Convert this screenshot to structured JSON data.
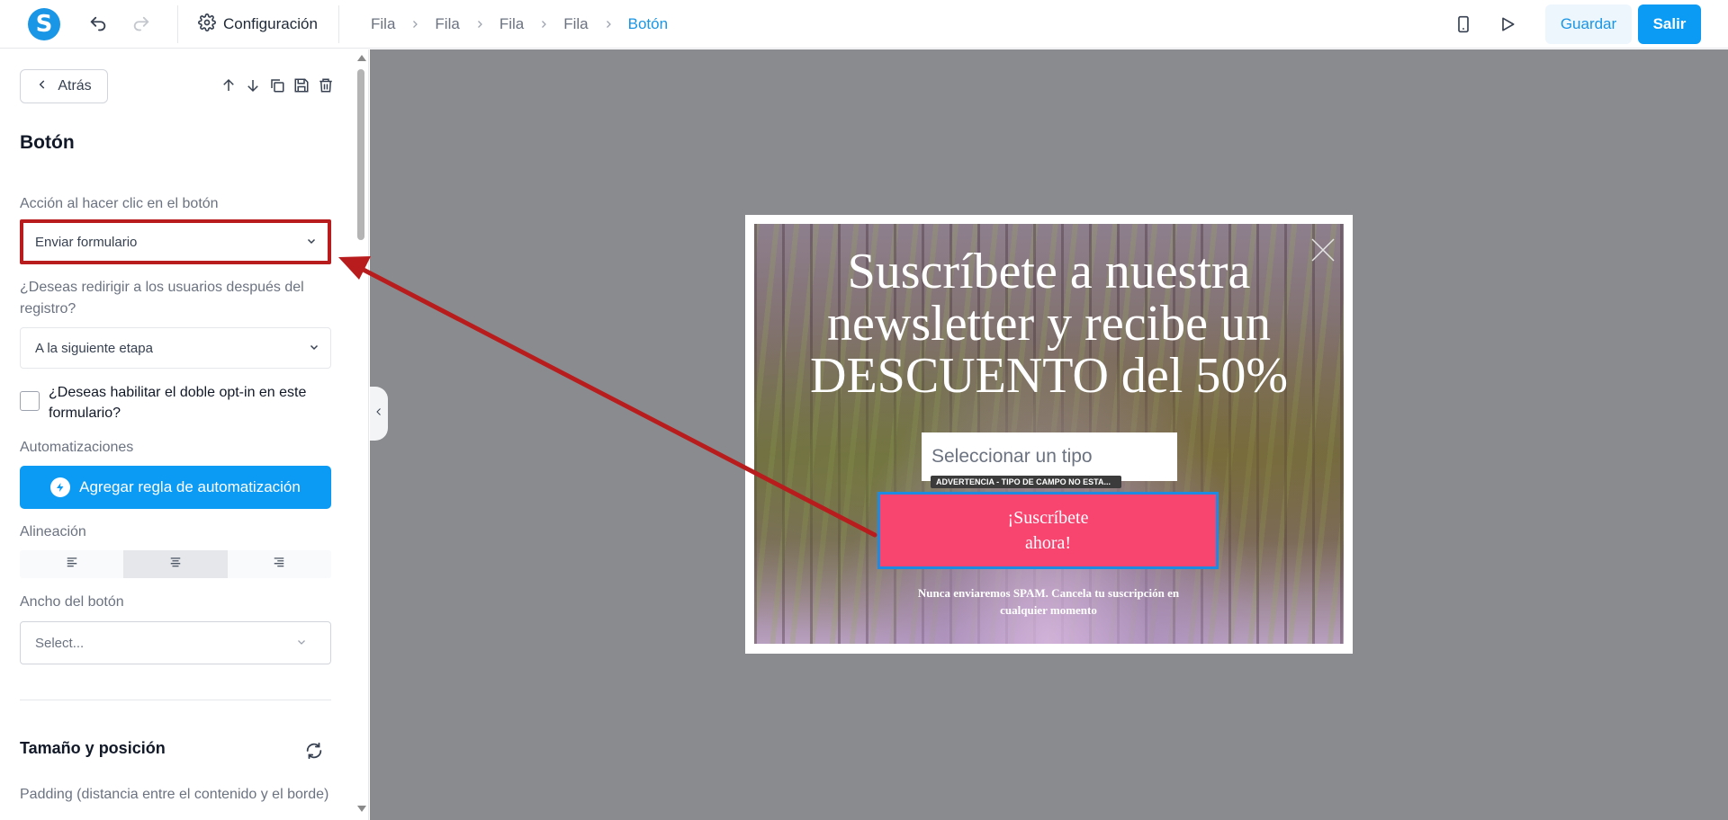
{
  "topbar": {
    "config_label": "Configuración",
    "breadcrumbs": [
      "Fila",
      "Fila",
      "Fila",
      "Fila",
      "Botón"
    ],
    "save_label": "Guardar",
    "exit_label": "Salir"
  },
  "sidebar": {
    "back_label": "Atrás",
    "title": "Botón",
    "action_label": "Acción al hacer clic en el botón",
    "action_value": "Enviar formulario",
    "redirect_label": "¿Deseas redirigir a los usuarios después del registro?",
    "redirect_value": "A la siguiente etapa",
    "double_optin_label": "¿Deseas habilitar el doble opt-in en este formulario?",
    "automations_label": "Automatizaciones",
    "add_rule_label": "Agregar regla de automatización",
    "alignment_label": "Alineación",
    "button_width_label": "Ancho del botón",
    "button_width_placeholder": "Select...",
    "size_position_title": "Tamaño y posición",
    "padding_label": "Padding (distancia entre el contenido y el borde)"
  },
  "popup": {
    "title": "Suscríbete a nuestra newsletter y recibe un DESCUENTO del 50%",
    "input_placeholder": "Seleccionar un tipo",
    "warning": "ADVERTENCIA - TIPO DE CAMPO NO ESTA...",
    "button_label": "¡Suscríbete ahora!",
    "note": "Nunca enviaremos SPAM. Cancela tu suscripción en cualquier momento"
  },
  "colors": {
    "accent": "#0b9bf5",
    "highlight": "#b91c1c",
    "cta": "#f74570",
    "canvas": "#8a8b8e"
  }
}
